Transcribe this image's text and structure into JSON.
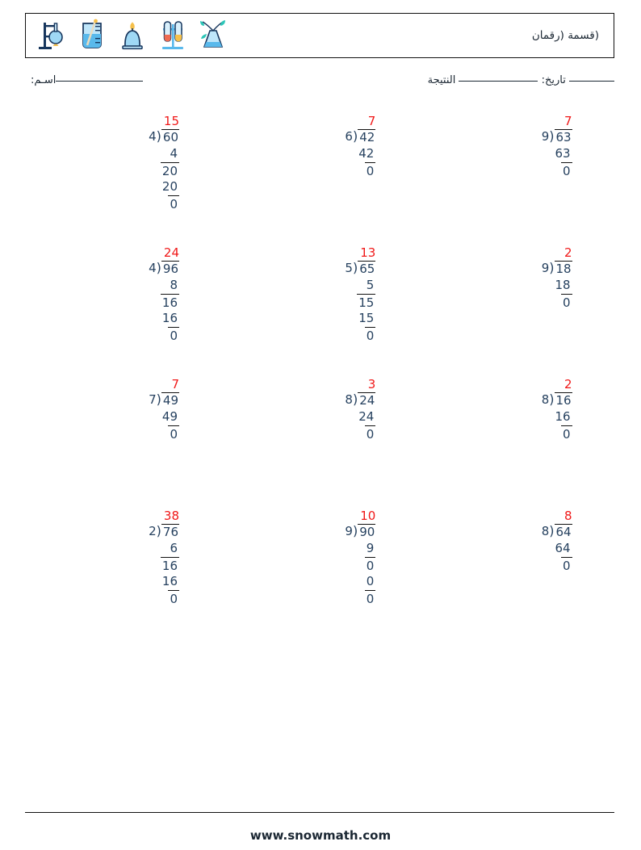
{
  "header": {
    "title": "(قسمة (رقمان",
    "icons": [
      "flask-stand-icon",
      "beaker-icon",
      "bunsen-burner-icon",
      "test-tube-rack-icon",
      "plant-flask-icon"
    ]
  },
  "meta": {
    "name_label": "اسـم:",
    "date_label": "تاريخ:",
    "score_label": "النتيجة"
  },
  "footer": {
    "site": "www.snowmath.com"
  },
  "colors": {
    "quotient": "#f01818",
    "digits": "#26415f",
    "rule": "#111111"
  },
  "problems": [
    {
      "id": 1,
      "quotient": "15",
      "divisor": "4",
      "dividend": "60",
      "steps": [
        {
          "text": "4",
          "bar": false
        },
        {
          "text": "20",
          "bar": true
        },
        {
          "text": "20",
          "bar": false
        },
        {
          "text": "0",
          "bar": true
        }
      ]
    },
    {
      "id": 2,
      "quotient": "7",
      "divisor": "6",
      "dividend": "42",
      "steps": [
        {
          "text": "42",
          "bar": false
        },
        {
          "text": "0",
          "bar": true
        }
      ]
    },
    {
      "id": 3,
      "quotient": "7",
      "divisor": "9",
      "dividend": "63",
      "steps": [
        {
          "text": "63",
          "bar": false
        },
        {
          "text": "0",
          "bar": true
        }
      ]
    },
    {
      "id": 4,
      "quotient": "24",
      "divisor": "4",
      "dividend": "96",
      "steps": [
        {
          "text": "8",
          "bar": false
        },
        {
          "text": "16",
          "bar": true
        },
        {
          "text": "16",
          "bar": false
        },
        {
          "text": "0",
          "bar": true
        }
      ]
    },
    {
      "id": 5,
      "quotient": "13",
      "divisor": "5",
      "dividend": "65",
      "steps": [
        {
          "text": "5",
          "bar": false
        },
        {
          "text": "15",
          "bar": true
        },
        {
          "text": "15",
          "bar": false
        },
        {
          "text": "0",
          "bar": true
        }
      ]
    },
    {
      "id": 6,
      "quotient": "2",
      "divisor": "9",
      "dividend": "18",
      "steps": [
        {
          "text": "18",
          "bar": false
        },
        {
          "text": "0",
          "bar": true
        }
      ]
    },
    {
      "id": 7,
      "quotient": "7",
      "divisor": "7",
      "dividend": "49",
      "steps": [
        {
          "text": "49",
          "bar": false
        },
        {
          "text": "0",
          "bar": true
        }
      ]
    },
    {
      "id": 8,
      "quotient": "3",
      "divisor": "8",
      "dividend": "24",
      "steps": [
        {
          "text": "24",
          "bar": false
        },
        {
          "text": "0",
          "bar": true
        }
      ]
    },
    {
      "id": 9,
      "quotient": "2",
      "divisor": "8",
      "dividend": "16",
      "steps": [
        {
          "text": "16",
          "bar": false
        },
        {
          "text": "0",
          "bar": true
        }
      ]
    },
    {
      "id": 10,
      "quotient": "38",
      "divisor": "2",
      "dividend": "76",
      "steps": [
        {
          "text": "6",
          "bar": false
        },
        {
          "text": "16",
          "bar": true
        },
        {
          "text": "16",
          "bar": false
        },
        {
          "text": "0",
          "bar": true
        }
      ]
    },
    {
      "id": 11,
      "quotient": "10",
      "divisor": "9",
      "dividend": "90",
      "steps": [
        {
          "text": "9",
          "bar": false
        },
        {
          "text": "0",
          "bar": true
        },
        {
          "text": "0",
          "bar": false
        },
        {
          "text": "0",
          "bar": true
        }
      ]
    },
    {
      "id": 12,
      "quotient": "8",
      "divisor": "8",
      "dividend": "64",
      "steps": [
        {
          "text": "64",
          "bar": false
        },
        {
          "text": "0",
          "bar": true
        }
      ]
    }
  ]
}
